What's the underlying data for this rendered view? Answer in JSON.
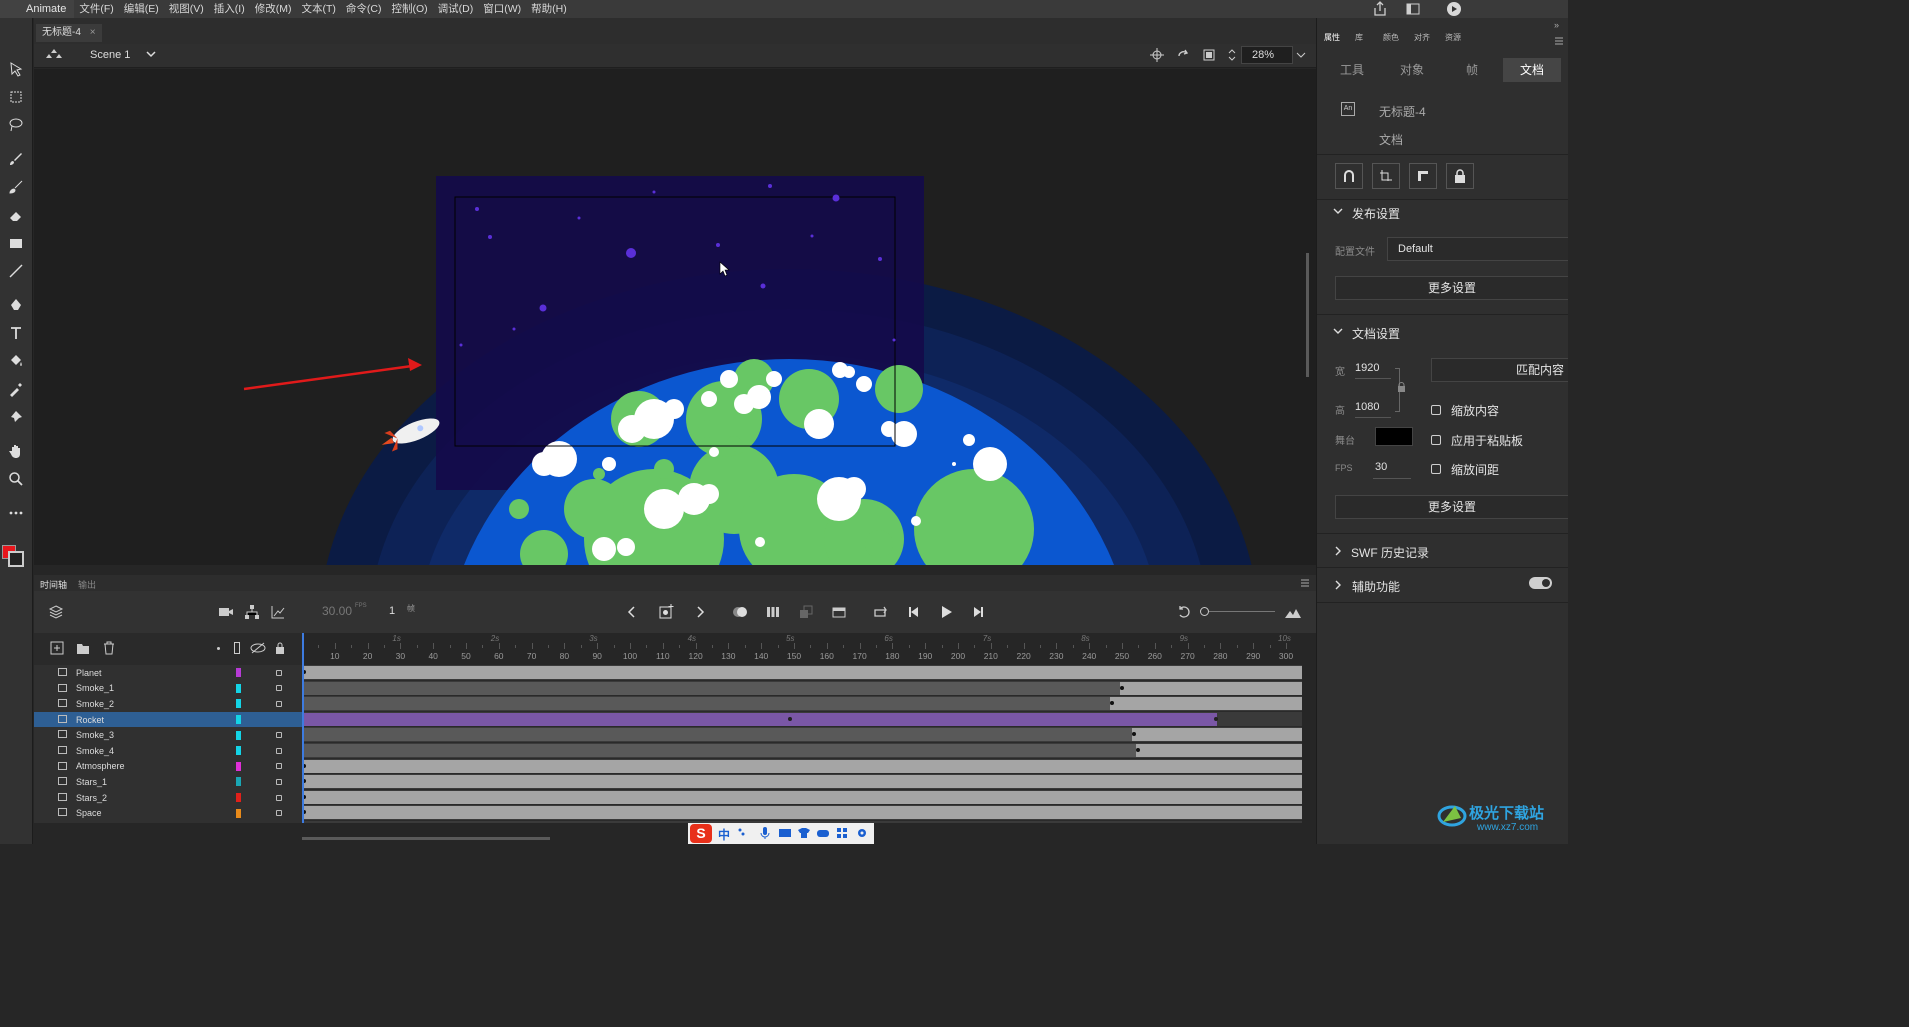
{
  "app": {
    "name": "Animate"
  },
  "menu": [
    "文件(F)",
    "编辑(E)",
    "视图(V)",
    "插入(I)",
    "修改(M)",
    "文本(T)",
    "命令(C)",
    "控制(O)",
    "调试(D)",
    "窗口(W)",
    "帮助(H)"
  ],
  "document": {
    "tab_title": "无标题-4",
    "close": "×"
  },
  "scene": {
    "name": "Scene 1",
    "zoom": "28%"
  },
  "colors": {
    "accent": "#2d5d8e",
    "stroke_swatch": "#e8161c",
    "layer_selected": "#2e5f94",
    "motion_tween": "#7a57a6",
    "arrow_annotation": "#e01a1a"
  },
  "timeline": {
    "tabs": [
      "时间轴",
      "输出"
    ],
    "fps": "30.00",
    "fps_unit": "FPS",
    "current_frame": "1",
    "frame_unit": "帧",
    "seconds": [
      "1s",
      "2s",
      "3s",
      "4s",
      "5s",
      "6s",
      "7s",
      "8s",
      "9s",
      "10s"
    ],
    "frame_ticks": [
      "10",
      "20",
      "30",
      "40",
      "50",
      "60",
      "70",
      "80",
      "90",
      "100",
      "110",
      "120",
      "130",
      "140",
      "150",
      "160",
      "170",
      "180",
      "190",
      "200",
      "210",
      "220",
      "230",
      "240",
      "250",
      "260",
      "270",
      "280",
      "290",
      "300"
    ],
    "layers": [
      {
        "name": "Planet",
        "color": "#b73bd6",
        "locked": true,
        "selected": false
      },
      {
        "name": "Smoke_1",
        "color": "#14d4e6",
        "locked": true,
        "selected": false
      },
      {
        "name": "Smoke_2",
        "color": "#14d4e6",
        "locked": true,
        "selected": false
      },
      {
        "name": "Rocket",
        "color": "#14d4e6",
        "locked": false,
        "selected": true
      },
      {
        "name": "Smoke_3",
        "color": "#14d4e6",
        "locked": true,
        "selected": false
      },
      {
        "name": "Smoke_4",
        "color": "#14d4e6",
        "locked": true,
        "selected": false
      },
      {
        "name": "Atmosphere",
        "color": "#e02fd8",
        "locked": true,
        "selected": false
      },
      {
        "name": "Stars_1",
        "color": "#1aa7b5",
        "locked": true,
        "selected": false
      },
      {
        "name": "Stars_2",
        "color": "#e0201a",
        "locked": true,
        "selected": false
      },
      {
        "name": "Space",
        "color": "#e88a1a",
        "locked": true,
        "selected": false
      }
    ]
  },
  "properties": {
    "panel_tabs": [
      "属性",
      "库",
      "颜色",
      "对齐",
      "资源"
    ],
    "subtabs": [
      "工具",
      "对象",
      "帧",
      "文档"
    ],
    "active_subtab": "文档",
    "doc_name": "无标题-4",
    "doc_type": "文档",
    "publish": {
      "title": "发布设置",
      "profile_label": "配置文件",
      "profile_value": "Default",
      "more": "更多设置"
    },
    "doc_settings": {
      "title": "文档设置",
      "width_label": "宽",
      "width": "1920",
      "height_label": "高",
      "height": "1080",
      "match_btn": "匹配内容",
      "stage_label": "舞台",
      "stage_color": "#000000",
      "fps_label": "FPS",
      "fps": "30",
      "scale_content": "缩放内容",
      "apply_pasteboard": "应用于粘贴板",
      "scale_spacing": "缩放间距",
      "more": "更多设置"
    },
    "swf_history": "SWF 历史记录",
    "accessibility": "辅助功能"
  },
  "ime": {
    "lang": "中"
  },
  "watermark": {
    "text": "极光下载站",
    "url": "www.xz7.com"
  }
}
